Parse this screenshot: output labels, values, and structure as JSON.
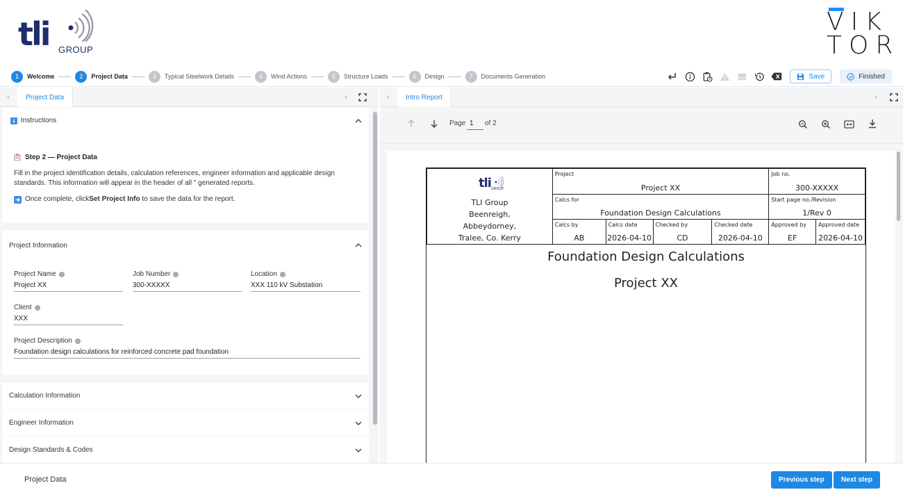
{
  "branding": {
    "tli_text": "tli",
    "tli_sub": "GROUP",
    "viktor_line1": "VIK",
    "viktor_line2": "TOR"
  },
  "stepper": {
    "steps": [
      {
        "num": "1",
        "label": "Welcome"
      },
      {
        "num": "2",
        "label": "Project Data"
      },
      {
        "num": "3",
        "label": "Typical Steelwork Details"
      },
      {
        "num": "4",
        "label": "Wind Actions"
      },
      {
        "num": "5",
        "label": "Structure Loads"
      },
      {
        "num": "6",
        "label": "Design"
      },
      {
        "num": "7",
        "label": "Documents Generation"
      }
    ],
    "active_step": "2"
  },
  "toolbar": {
    "save_label": "Save",
    "finished_label": "Finished"
  },
  "left_panel": {
    "tab_label": "Project Data",
    "instructions": {
      "title": "Instructions",
      "step_heading": "Step 2 — Project Data",
      "body": "Fill in the project identification details, calculation references, engineer information and applicable design standards. This information will appear in the header of all \" generated reports.",
      "once_prefix": "Once complete, click ",
      "once_bold": "Set Project Info",
      "once_suffix": " to save the data for the report."
    },
    "project_info": {
      "title": "Project Information",
      "project_name_label": "Project Name",
      "project_name_value": "Project XX",
      "job_number_label": "Job Number",
      "job_number_value": "300-XXXXX",
      "location_label": "Location",
      "location_value": "XXX 110 kV Substation",
      "client_label": "Client",
      "client_value": "XXX",
      "description_label": "Project Description",
      "description_value": "Foundation design calculations for reinforced concrete pad foundation"
    },
    "sections": [
      {
        "title": "Calculation Information"
      },
      {
        "title": "Engineer Information"
      },
      {
        "title": "Design Standards & Codes"
      }
    ]
  },
  "right_panel": {
    "tab_label": "Intro Report",
    "page_label": "Page",
    "page_value": "1",
    "page_of": "of 2"
  },
  "report": {
    "logo_text": "tli",
    "logo_sub": "GROUP",
    "company_lines": [
      "TLI Group",
      "Beenreigh,",
      "Abbeydorney,",
      "Tralee, Co. Kerry"
    ],
    "project_label": "Project",
    "project_value": "Project XX",
    "job_label": "Job no.",
    "job_value": "300-XXXXX",
    "calcs_for_label": "Calcs for",
    "calcs_for_value": "Foundation Design Calculations",
    "start_page_label": "Start page no./Revision",
    "start_page_value": "1/Rev 0",
    "calcs_by_label": "Calcs by",
    "calcs_by_value": "AB",
    "calcs_date_label": "Calcs date",
    "calcs_date_value": "2026-04-10",
    "checked_by_label": "Checked by",
    "checked_by_value": "CD",
    "checked_date_label": "Checked date",
    "checked_date_value": "2026-04-10",
    "approved_by_label": "Approved by",
    "approved_by_value": "EF",
    "approved_date_label": "Approved date",
    "approved_date_value": "2026-04-10",
    "title": "Foundation Design Calculations",
    "subtitle": "Project XX"
  },
  "footer": {
    "title": "Project Data",
    "prev_label": "Previous step",
    "next_label": "Next step"
  },
  "colors": {
    "accent": "#1e88e5",
    "brand_navy": "#1f2d6b",
    "step_inactive": "#c2c6cc"
  }
}
